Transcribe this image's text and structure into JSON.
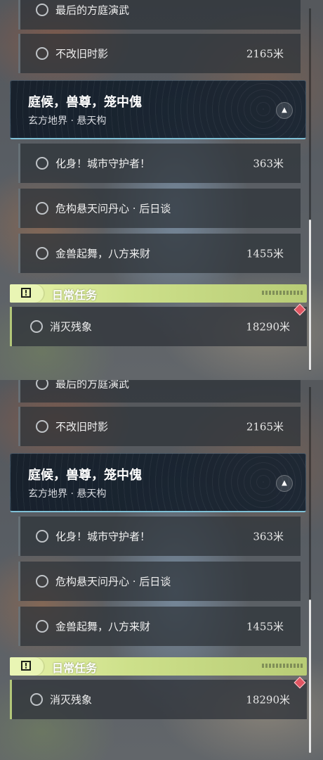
{
  "panels": [
    {
      "prev_task": {
        "name": "最后的方庭演武"
      },
      "top_task": {
        "name": "不改旧时影",
        "distance": "2165米"
      },
      "quest": {
        "title": "庭候，兽尊，笼中傀",
        "subtitle": "玄方地界 · 悬天构",
        "collapse_icon": "chevron-up-icon"
      },
      "tasks": [
        {
          "name": "化身！城市守护者！",
          "distance": "363米"
        },
        {
          "name": "危构悬天问丹心 · 后日谈",
          "distance": ""
        },
        {
          "name": "金兽起舞，八方来财",
          "distance": "1455米"
        }
      ],
      "daily": {
        "title": "日常任务",
        "task": {
          "name": "消灭残象",
          "distance": "18290米"
        }
      }
    },
    {
      "prev_task": {
        "name": "最后的方庭演武"
      },
      "top_task": {
        "name": "不改旧时影",
        "distance": "2165米"
      },
      "quest": {
        "title": "庭候，兽尊，笼中傀",
        "subtitle": "玄方地界 · 悬天构",
        "collapse_icon": "chevron-up-icon"
      },
      "tasks": [
        {
          "name": "化身！城市守护者！",
          "distance": "363米"
        },
        {
          "name": "危构悬天问丹心 · 后日谈",
          "distance": ""
        },
        {
          "name": "金兽起舞，八方来财",
          "distance": "1455米"
        }
      ],
      "daily": {
        "title": "日常任务",
        "task": {
          "name": "消灭残象",
          "distance": "18290米"
        }
      }
    }
  ],
  "colors": {
    "accent_daily": "#cde08a",
    "quest_underline": "#7fc0d6",
    "tracker_diamond": "#e05562"
  }
}
